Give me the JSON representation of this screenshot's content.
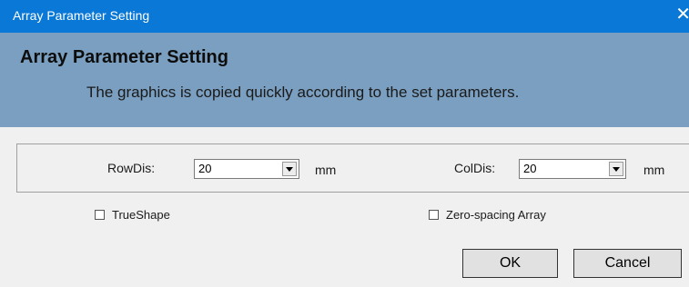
{
  "window": {
    "title": "Array Parameter Setting",
    "close_glyph": "✕"
  },
  "header": {
    "title": "Array Parameter Setting",
    "description": "The graphics is copied quickly according to the set parameters."
  },
  "fields": {
    "row": {
      "label": "RowDis:",
      "value": "20",
      "unit": "mm"
    },
    "col": {
      "label": "ColDis:",
      "value": "20",
      "unit": "mm"
    }
  },
  "options": {
    "true_shape": {
      "label": "TrueShape",
      "checked": false
    },
    "zero_spacing": {
      "label": "Zero-spacing Array",
      "checked": false
    }
  },
  "buttons": {
    "ok": "OK",
    "cancel": "Cancel"
  },
  "colors": {
    "titlebar": "#0a78d7",
    "header_band": "#7a9fc0",
    "dialog_bg": "#f0f0f0"
  }
}
